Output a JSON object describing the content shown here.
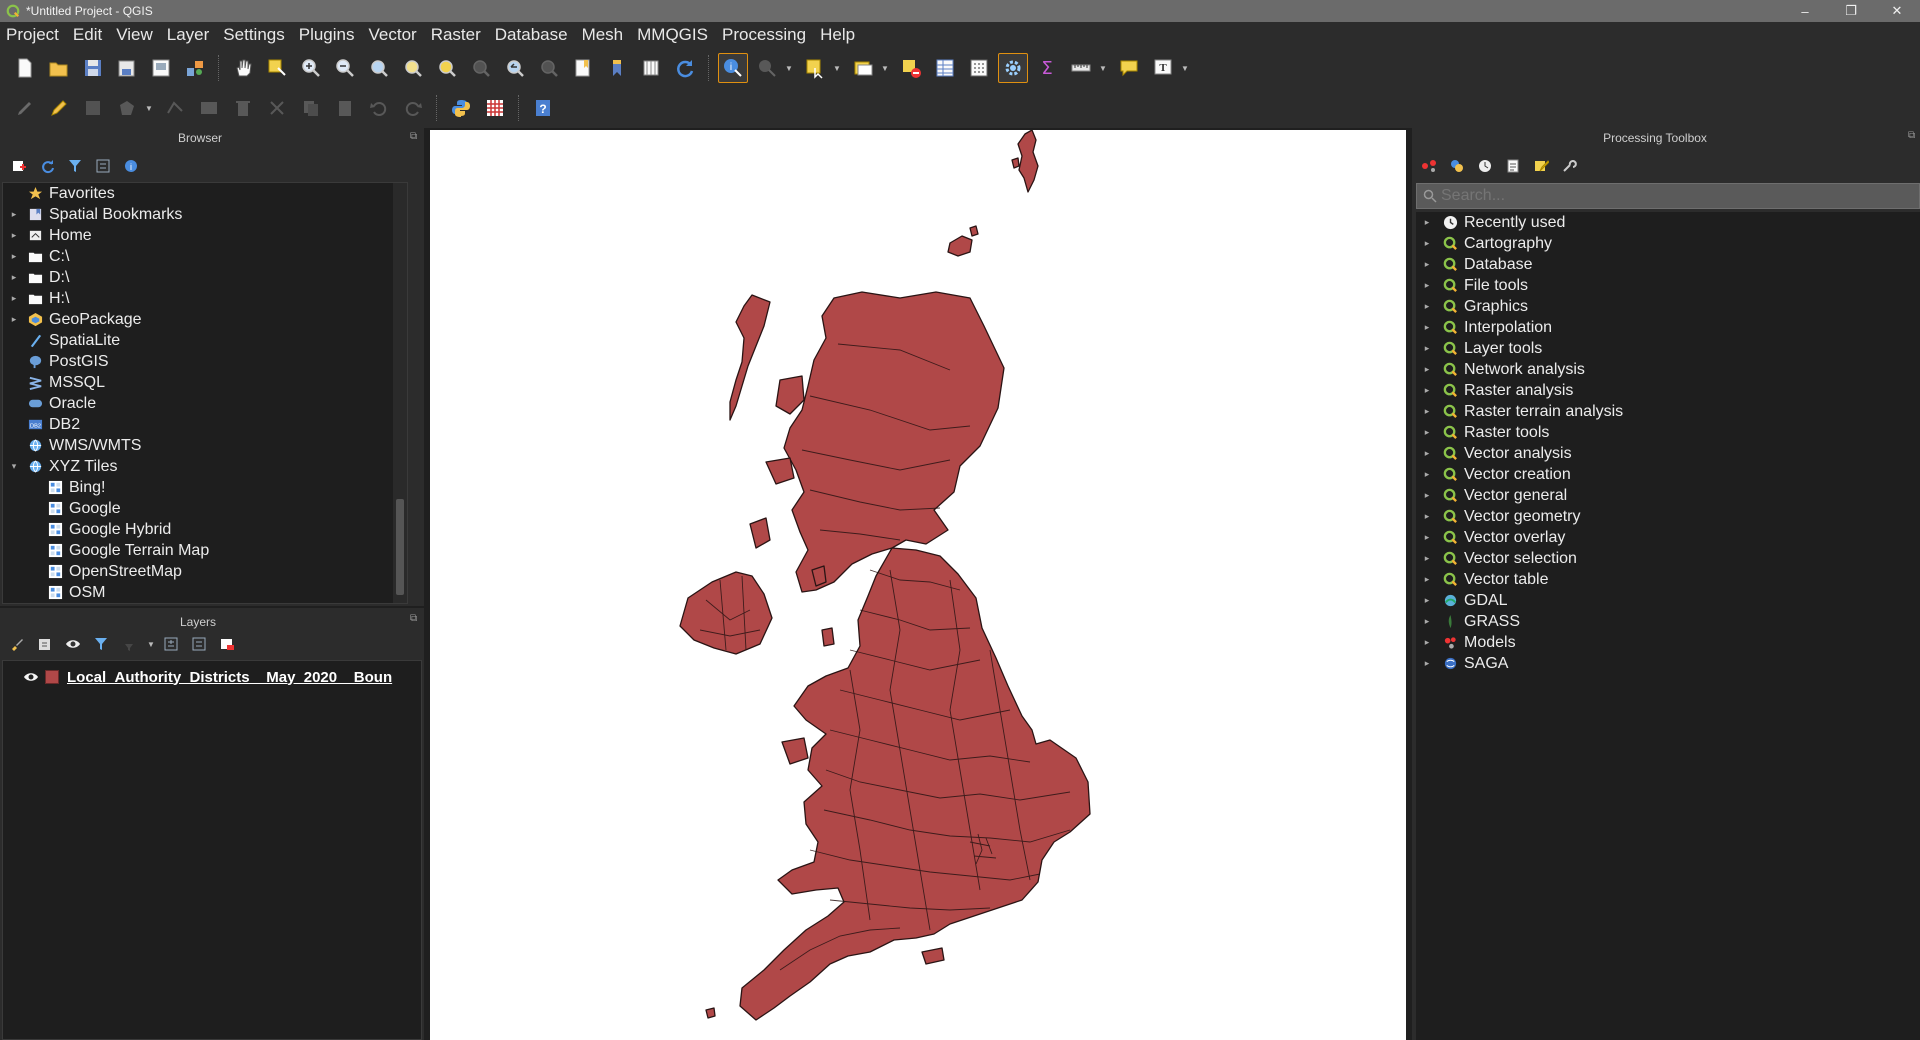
{
  "window": {
    "title": "*Untitled Project - QGIS",
    "controls": [
      "–",
      "❐",
      "✕"
    ]
  },
  "menu": [
    "Project",
    "Edit",
    "View",
    "Layer",
    "Settings",
    "Plugins",
    "Vector",
    "Raster",
    "Database",
    "Mesh",
    "MMQGIS",
    "Processing",
    "Help"
  ],
  "toolbar1": [
    "new-project",
    "open-project",
    "save-project",
    "save-as",
    "print-layout",
    "layout-manager",
    "pan",
    "pan-to-selection",
    "zoom-in",
    "zoom-out",
    "zoom-full",
    "zoom-layer",
    "zoom-selection",
    "zoom-native",
    "zoom-last",
    "zoom-next",
    "new-bookmark",
    "show-bookmarks",
    "temporal",
    "refresh",
    "identify",
    "map-tips",
    "select-features",
    "deselect",
    "open-attribute-table",
    "field-calculator",
    "processing-toolbox",
    "statistical-summary",
    "measure",
    "annotation",
    "text-annotation"
  ],
  "toolbar2": [
    "current-edits",
    "toggle-editing",
    "save-edits",
    "digitize",
    "vertex-tool",
    "delete-selected",
    "cut-features",
    "copy-features",
    "paste-features",
    "undo",
    "redo",
    "python-console",
    "grid",
    "help"
  ],
  "browser": {
    "title": "Browser",
    "items": [
      {
        "label": "Favorites",
        "icon": "star-icon",
        "arrow": ""
      },
      {
        "label": "Spatial Bookmarks",
        "icon": "bookmark-icon",
        "arrow": "▸"
      },
      {
        "label": "Home",
        "icon": "home-icon",
        "arrow": "▸"
      },
      {
        "label": "C:\\",
        "icon": "folder-icon",
        "arrow": "▸"
      },
      {
        "label": "D:\\",
        "icon": "folder-icon",
        "arrow": "▸"
      },
      {
        "label": "H:\\",
        "icon": "folder-icon",
        "arrow": "▸"
      },
      {
        "label": "GeoPackage",
        "icon": "geopackage-icon",
        "arrow": "▸"
      },
      {
        "label": "SpatiaLite",
        "icon": "spatialite-icon",
        "arrow": ""
      },
      {
        "label": "PostGIS",
        "icon": "postgis-icon",
        "arrow": ""
      },
      {
        "label": "MSSQL",
        "icon": "mssql-icon",
        "arrow": ""
      },
      {
        "label": "Oracle",
        "icon": "oracle-icon",
        "arrow": ""
      },
      {
        "label": "DB2",
        "icon": "db2-icon",
        "arrow": ""
      },
      {
        "label": "WMS/WMTS",
        "icon": "wms-icon",
        "arrow": ""
      },
      {
        "label": "XYZ Tiles",
        "icon": "xyz-icon",
        "arrow": "▾"
      }
    ],
    "xyz_children": [
      "Bing!",
      "Google",
      "Google Hybrid",
      "Google Terrain Map",
      "OpenStreetMap",
      "OSM"
    ]
  },
  "layers": {
    "title": "Layers",
    "items": [
      {
        "name": "Local_Authority_Districts__May_2020__Boun",
        "color": "#b04848",
        "visible": true
      }
    ]
  },
  "map": {
    "fill_color": "#b04848",
    "stroke_color": "#2a1414",
    "background": "#ffffff"
  },
  "toolbox": {
    "title": "Processing Toolbox",
    "search_placeholder": "Search...",
    "groups": [
      {
        "label": "Recently used",
        "icon": "clock-icon"
      },
      {
        "label": "Cartography",
        "icon": "qgis-icon"
      },
      {
        "label": "Database",
        "icon": "qgis-icon"
      },
      {
        "label": "File tools",
        "icon": "qgis-icon"
      },
      {
        "label": "Graphics",
        "icon": "qgis-icon"
      },
      {
        "label": "Interpolation",
        "icon": "qgis-icon"
      },
      {
        "label": "Layer tools",
        "icon": "qgis-icon"
      },
      {
        "label": "Network analysis",
        "icon": "qgis-icon"
      },
      {
        "label": "Raster analysis",
        "icon": "qgis-icon"
      },
      {
        "label": "Raster terrain analysis",
        "icon": "qgis-icon"
      },
      {
        "label": "Raster tools",
        "icon": "qgis-icon"
      },
      {
        "label": "Vector analysis",
        "icon": "qgis-icon"
      },
      {
        "label": "Vector creation",
        "icon": "qgis-icon"
      },
      {
        "label": "Vector general",
        "icon": "qgis-icon"
      },
      {
        "label": "Vector geometry",
        "icon": "qgis-icon"
      },
      {
        "label": "Vector overlay",
        "icon": "qgis-icon"
      },
      {
        "label": "Vector selection",
        "icon": "qgis-icon"
      },
      {
        "label": "Vector table",
        "icon": "qgis-icon"
      },
      {
        "label": "GDAL",
        "icon": "gdal-icon"
      },
      {
        "label": "GRASS",
        "icon": "grass-icon"
      },
      {
        "label": "Models",
        "icon": "models-icon"
      },
      {
        "label": "SAGA",
        "icon": "saga-icon"
      }
    ]
  }
}
